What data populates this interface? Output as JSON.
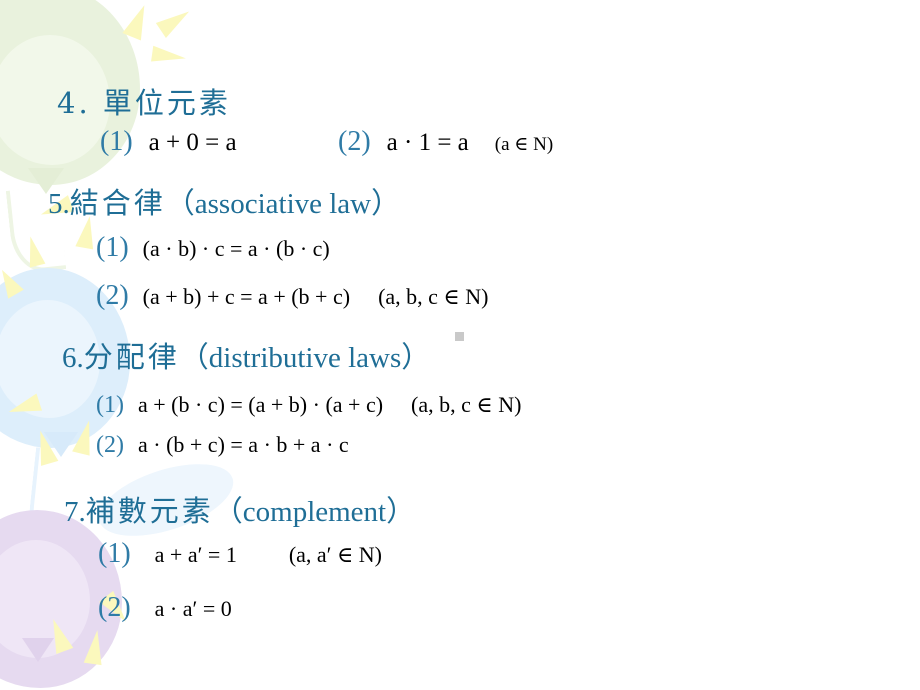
{
  "slide": {
    "background_color": "#ffffff",
    "heading_color": "#1f6e96",
    "marker_color": "#2f7ba6",
    "math_color": "#000000",
    "decor_colors": {
      "balloon_green": "#e8f2dc",
      "balloon_blue": "#dceefb",
      "balloon_purple": "#e6daf0",
      "streamer_yellow": "#fbf7bc"
    }
  },
  "sections": [
    {
      "id": "unit-element",
      "number": "4.",
      "title_cjk": "單位元素",
      "title_latin": "",
      "items": [
        {
          "marker": "(1)",
          "expr": "a + 0 = a",
          "domain": "(a ∈ N)"
        },
        {
          "marker": "(2)",
          "expr": "a · 1 = a",
          "domain": ""
        }
      ]
    },
    {
      "id": "associative-law",
      "number": "5.",
      "title_cjk": "結合律",
      "title_latin": "（associative law）",
      "items": [
        {
          "marker": "(1)",
          "expr": "(a · b) · c = a · (b · c)",
          "domain": ""
        },
        {
          "marker": "(2)",
          "expr": "(a + b) + c = a + (b + c)",
          "domain": "(a, b, c ∈ N)"
        }
      ]
    },
    {
      "id": "distributive-laws",
      "number": "6.",
      "title_cjk": "分配律",
      "title_latin": "（distributive laws）",
      "items": [
        {
          "marker": "(1)",
          "expr": "a + (b · c) = (a + b) · (a + c)",
          "domain": "(a, b, c ∈ N)"
        },
        {
          "marker": "(2)",
          "expr": "a · (b + c) = a · b + a · c",
          "domain": ""
        }
      ]
    },
    {
      "id": "complement",
      "number": "7.",
      "title_cjk": "補數元素",
      "title_latin": "（complement）",
      "items": [
        {
          "marker": "(1)",
          "expr": "a + a′ = 1",
          "domain": "(a, a′ ∈ N)"
        },
        {
          "marker": "(2)",
          "expr": "a · a′ = 0",
          "domain": ""
        }
      ]
    }
  ],
  "lines": {
    "s4_title": "4. 單位元素",
    "s4_i1_marker": "(1)",
    "s4_i1_expr": "a + 0 = a",
    "s4_i2_marker": "(2)",
    "s4_i2_expr": "a · 1 = a",
    "s4_i2_domain": "(a ∈ N)",
    "s5_num": "5.",
    "s5_cjk": "結合律",
    "s5_lat": "（associative law）",
    "s5_i1_marker": "(1)",
    "s5_i1_expr": "(a · b) · c = a · (b · c)",
    "s5_i2_marker": "(2)",
    "s5_i2_expr": "(a + b) + c = a + (b + c)",
    "s5_i2_domain": "(a, b, c ∈ N)",
    "s6_num": "6.",
    "s6_cjk": "分配律",
    "s6_lat": "（distributive laws）",
    "s6_i1_marker": "(1)",
    "s6_i1_expr": "a + (b · c) = (a + b) · (a + c)",
    "s6_i1_domain": "(a, b, c ∈ N)",
    "s6_i2_marker": "(2)",
    "s6_i2_expr": "a · (b + c) = a · b + a · c",
    "s7_num": "7.",
    "s7_cjk": "補數元素",
    "s7_lat": "（complement）",
    "s7_i1_marker": "(1)",
    "s7_i1_expr": "a + a′ = 1",
    "s7_i1_domain": "(a, a′ ∈ N)",
    "s7_i2_marker": "(2)",
    "s7_i2_expr": "a · a′ = 0"
  }
}
